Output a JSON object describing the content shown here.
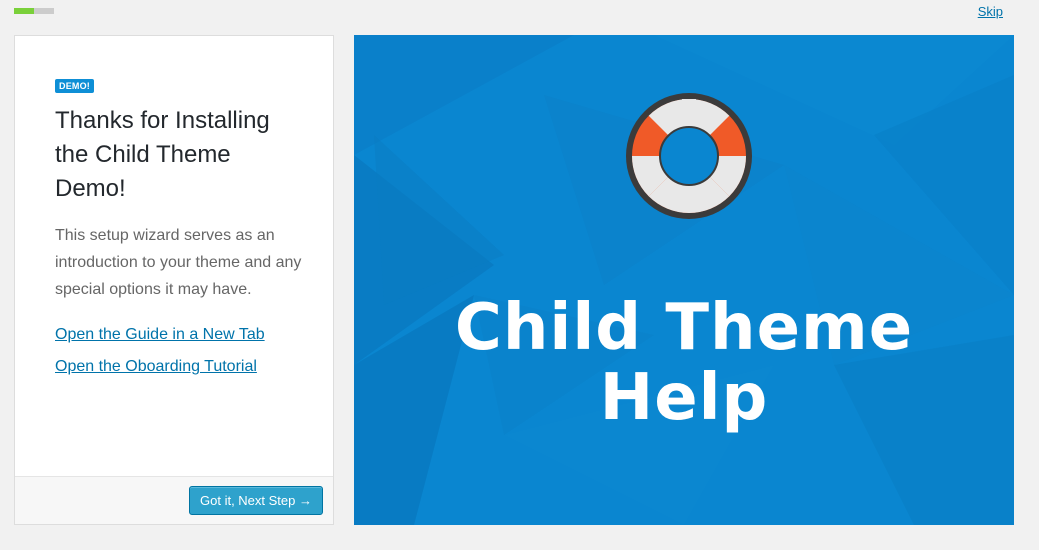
{
  "progress": {
    "total_steps": 2,
    "completed_steps": 1,
    "done_color": "#7ad03a",
    "todo_color": "#cccccc"
  },
  "header": {
    "skip_label": "Skip"
  },
  "card": {
    "badge": "DEMO!",
    "title": "Thanks for Installing the Child Theme Demo!",
    "description": "This setup wizard serves as an introduction to your theme and any special options it may have.",
    "links": [
      {
        "label": "Open the Guide in a New Tab"
      },
      {
        "label": "Open the Oboarding Tutorial"
      }
    ],
    "next_button": "Got it, Next Step →"
  },
  "hero": {
    "icon": "lifebuoy-icon",
    "title_line1": "Child Theme",
    "title_line2": "Help",
    "background_color": "#0a86d0",
    "accent_color": "#f05a28"
  }
}
